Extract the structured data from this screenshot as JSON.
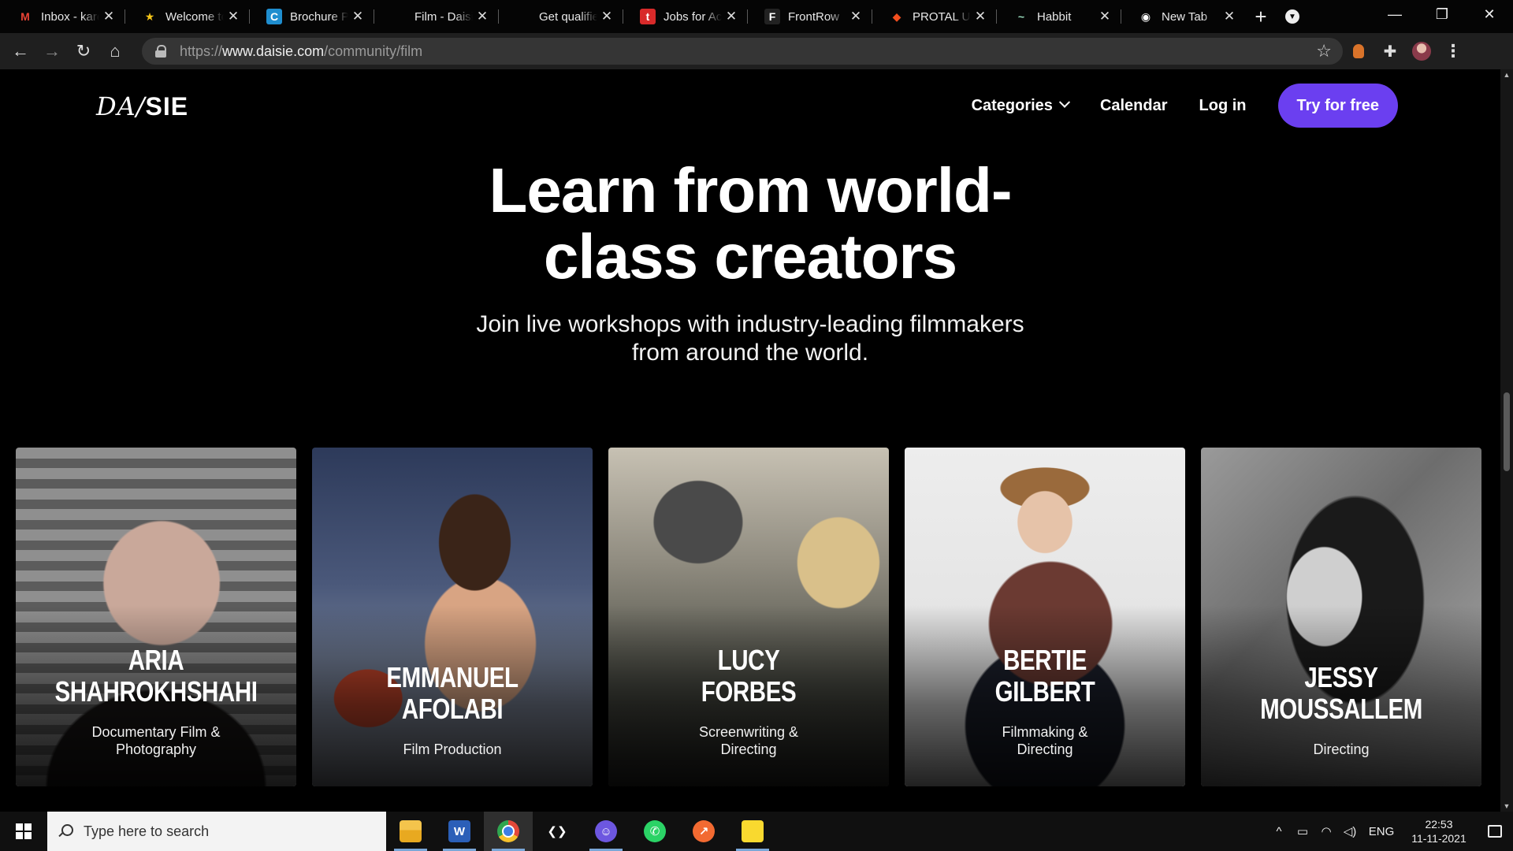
{
  "browser": {
    "tabs": [
      {
        "title": "Inbox - karen",
        "icon": "gmail-icon",
        "fav": "M",
        "fav_color": "#ea4335",
        "fav_bg": "transparent"
      },
      {
        "title": "Welcome to",
        "icon": "star-icon",
        "fav": "★",
        "fav_color": "#f5c518",
        "fav_bg": "transparent"
      },
      {
        "title": "Brochure PP",
        "icon": "canva-icon",
        "fav": "C",
        "fav_color": "#ffffff",
        "fav_bg": "#1f8ecf"
      },
      {
        "title": "Film - Daisie",
        "icon": "daisie-icon",
        "fav": "",
        "fav_color": "#ffffff",
        "fav_bg": "transparent"
      },
      {
        "title": "Get qualified",
        "icon": "blank-icon",
        "fav": "",
        "fav_color": "#ffffff",
        "fav_bg": "transparent"
      },
      {
        "title": "Jobs for Act",
        "icon": "jobs-icon",
        "fav": "t",
        "fav_color": "#ffffff",
        "fav_bg": "#d82a2a"
      },
      {
        "title": "FrontRow",
        "icon": "frontrow-icon",
        "fav": "F",
        "fav_color": "#ffffff",
        "fav_bg": "#222222"
      },
      {
        "title": "PROTAL UI/",
        "icon": "figma-icon",
        "fav": "◆",
        "fav_color": "#f24e1e",
        "fav_bg": "transparent"
      },
      {
        "title": "Habbit",
        "icon": "habbit-icon",
        "fav": "~",
        "fav_color": "#9be0c0",
        "fav_bg": "transparent"
      },
      {
        "title": "New Tab",
        "icon": "chrome-icon",
        "fav": "◉",
        "fav_color": "#ffffff",
        "fav_bg": "transparent"
      }
    ],
    "new_tab_label": "+",
    "url": {
      "scheme": "https://",
      "host": "www.daisie.com",
      "path": "/community/film"
    }
  },
  "site": {
    "logo": {
      "left": "DA/",
      "right": "SIE"
    },
    "nav": {
      "categories": "Categories",
      "calendar": "Calendar",
      "login": "Log in",
      "cta": "Try for free"
    },
    "accent_color": "#6b3ff0"
  },
  "hero": {
    "title_line1": "Learn from world-",
    "title_line2": "class creators",
    "subtitle_line1": "Join live workshops with industry-leading filmmakers",
    "subtitle_line2": "from around the world."
  },
  "creators": [
    {
      "first": "ARIA",
      "last": "SHAHROKHSHAHI",
      "role1": "Documentary Film &",
      "role2": "Photography"
    },
    {
      "first": "EMMANUEL",
      "last": "AFOLABI",
      "role1": "Film Production",
      "role2": ""
    },
    {
      "first": "LUCY",
      "last": "FORBES",
      "role1": "Screenwriting &",
      "role2": "Directing"
    },
    {
      "first": "BERTIE",
      "last": "GILBERT",
      "role1": "Filmmaking &",
      "role2": "Directing"
    },
    {
      "first": "JESSY",
      "last": "MOUSSALLEM",
      "role1": "Directing",
      "role2": ""
    }
  ],
  "taskbar": {
    "search_placeholder": "Type here to search",
    "apps": [
      "file-explorer-icon",
      "word-icon",
      "chrome-icon",
      "vscode-icon",
      "discord-icon",
      "whatsapp-icon",
      "postman-icon",
      "sticky-notes-icon"
    ],
    "language": "ENG",
    "time": "22:53",
    "date": "11-11-2021"
  }
}
